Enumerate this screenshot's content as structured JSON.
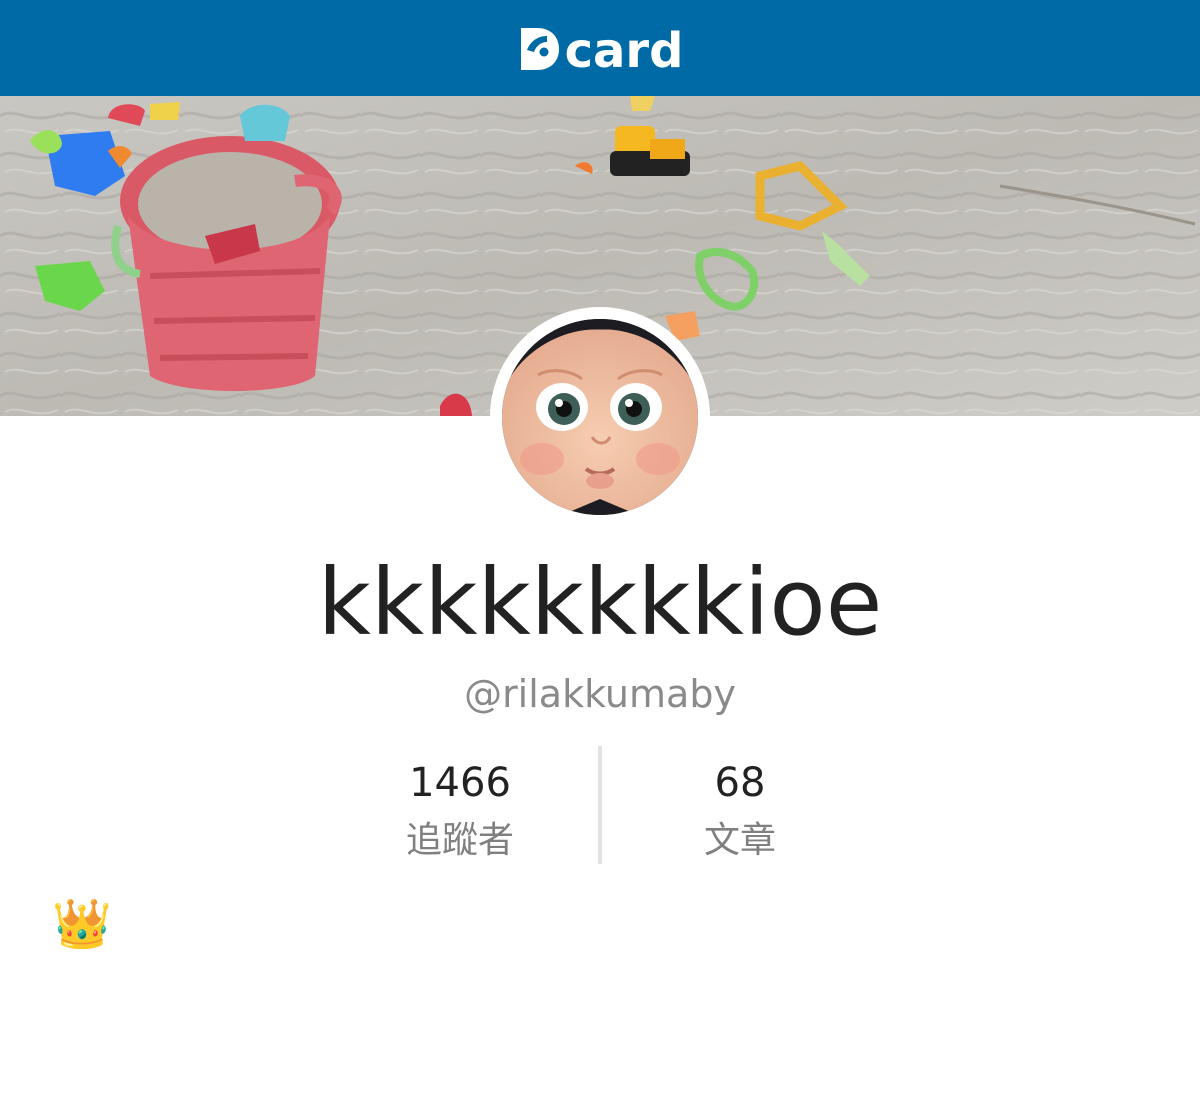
{
  "header": {
    "logo_text": "card",
    "brand_color": "#006aa6"
  },
  "cover": {
    "alt": "cover-photo"
  },
  "avatar": {
    "icon": "avatar-image"
  },
  "profile": {
    "display_name": "kkkkkkkkioe",
    "handle": "@rilakkumaby"
  },
  "stats": [
    {
      "value": "1466",
      "label": "追蹤者"
    },
    {
      "value": "68",
      "label": "文章"
    }
  ],
  "bio": {
    "text": "👑"
  }
}
